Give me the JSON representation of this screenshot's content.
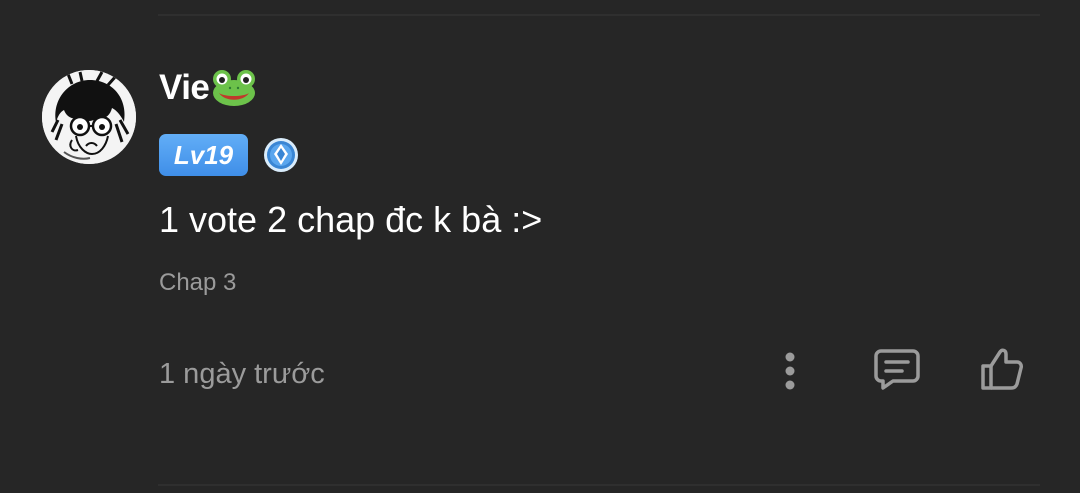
{
  "comment": {
    "username": "Vie",
    "name_emoji": "frog-face",
    "level": "Lv19",
    "rank_icon": "blue-crest-icon",
    "text": "1 vote 2 chap đc k bà :>",
    "chapter": "Chap 3",
    "time": "1 ngày trước"
  },
  "actions": {
    "more_icon": "more-vertical-icon",
    "reply_icon": "comment-icon",
    "like_icon": "thumbs-up-icon"
  },
  "colors": {
    "background": "#262626",
    "primary_text": "#ffffff",
    "secondary_text": "#9b9b9b",
    "level_badge": "#4a98ee"
  }
}
